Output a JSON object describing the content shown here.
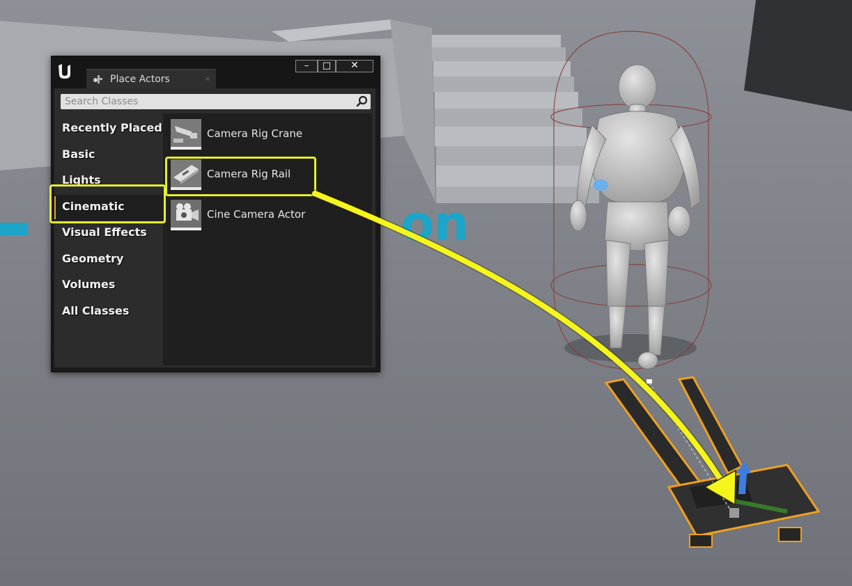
{
  "panel": {
    "tab_title": "Place Actors",
    "tab_close": "×",
    "window_buttons": {
      "minimize": "–",
      "maximize": "□",
      "close": "✕"
    },
    "search": {
      "placeholder": "Search Classes",
      "value": ""
    },
    "categories": [
      {
        "label": "Recently Placed",
        "selected": false
      },
      {
        "label": "Basic",
        "selected": false
      },
      {
        "label": "Lights",
        "selected": false
      },
      {
        "label": "Cinematic",
        "selected": true
      },
      {
        "label": "Visual Effects",
        "selected": false
      },
      {
        "label": "Geometry",
        "selected": false
      },
      {
        "label": "Volumes",
        "selected": false
      },
      {
        "label": "All Classes",
        "selected": false
      }
    ],
    "items": [
      {
        "label": "Camera Rig Crane",
        "icon": "camera-rig-crane-icon"
      },
      {
        "label": "Camera Rig Rail",
        "icon": "camera-rig-rail-icon"
      },
      {
        "label": "Cine Camera Actor",
        "icon": "cine-camera-actor-icon"
      }
    ]
  },
  "annotations": {
    "highlight_color": "#e6ef2a",
    "selection_accent": "#e8a33a",
    "highlighted": [
      "Cinematic",
      "Camera Rig Rail"
    ]
  },
  "viewport": {
    "floor_text": "on",
    "floor_text_color": "#1aa5c9",
    "selected_outline_color": "#f0a020"
  }
}
